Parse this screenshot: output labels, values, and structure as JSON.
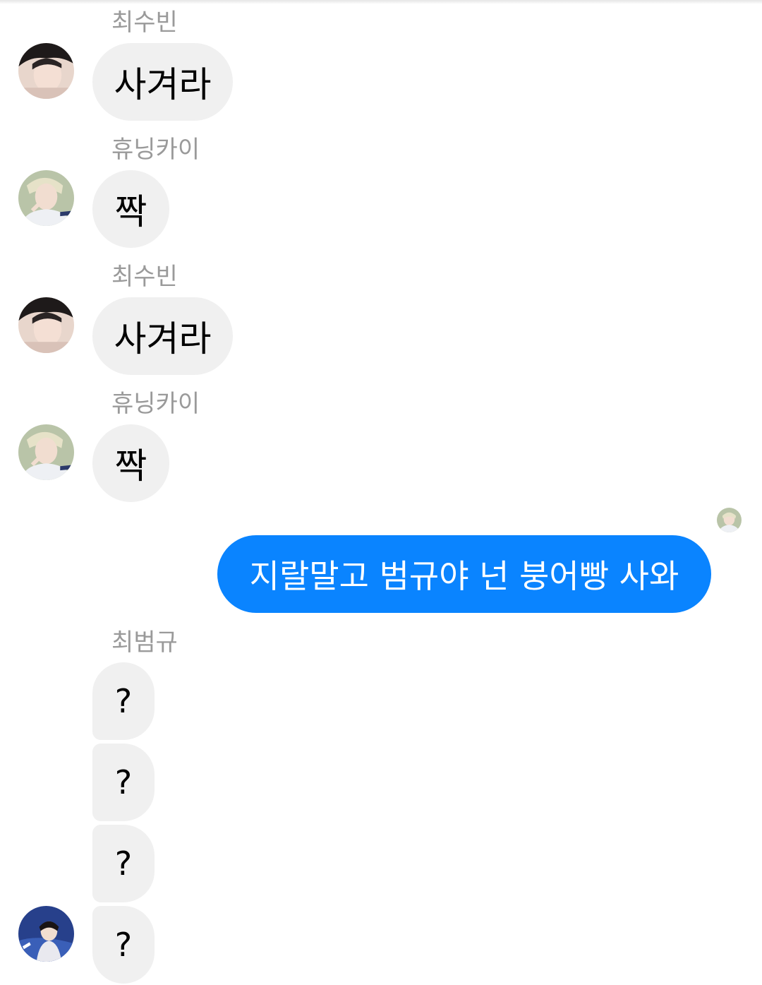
{
  "messages": [
    {
      "sender": "최수빈",
      "text": "사겨라"
    },
    {
      "sender": "휴닝카이",
      "text": "짝"
    },
    {
      "sender": "최수빈",
      "text": "사겨라"
    },
    {
      "sender": "휴닝카이",
      "text": "짝"
    }
  ],
  "outgoing": {
    "text": "지랄말고 범규야 넌 붕어빵 사와"
  },
  "beomgyu": {
    "sender": "최범규",
    "bubbles": [
      "?",
      "?",
      "?",
      "?"
    ]
  },
  "colors": {
    "outgoing_bubble": "#0a84ff",
    "incoming_bubble": "#f0f0f0",
    "sender_name": "#9a9a9a"
  },
  "icons": {
    "soobin_avatar": "avatar-photo",
    "hueningkai_avatar": "avatar-photo",
    "beomgyu_avatar": "avatar-photo",
    "seen_indicator": "seen-avatar"
  }
}
